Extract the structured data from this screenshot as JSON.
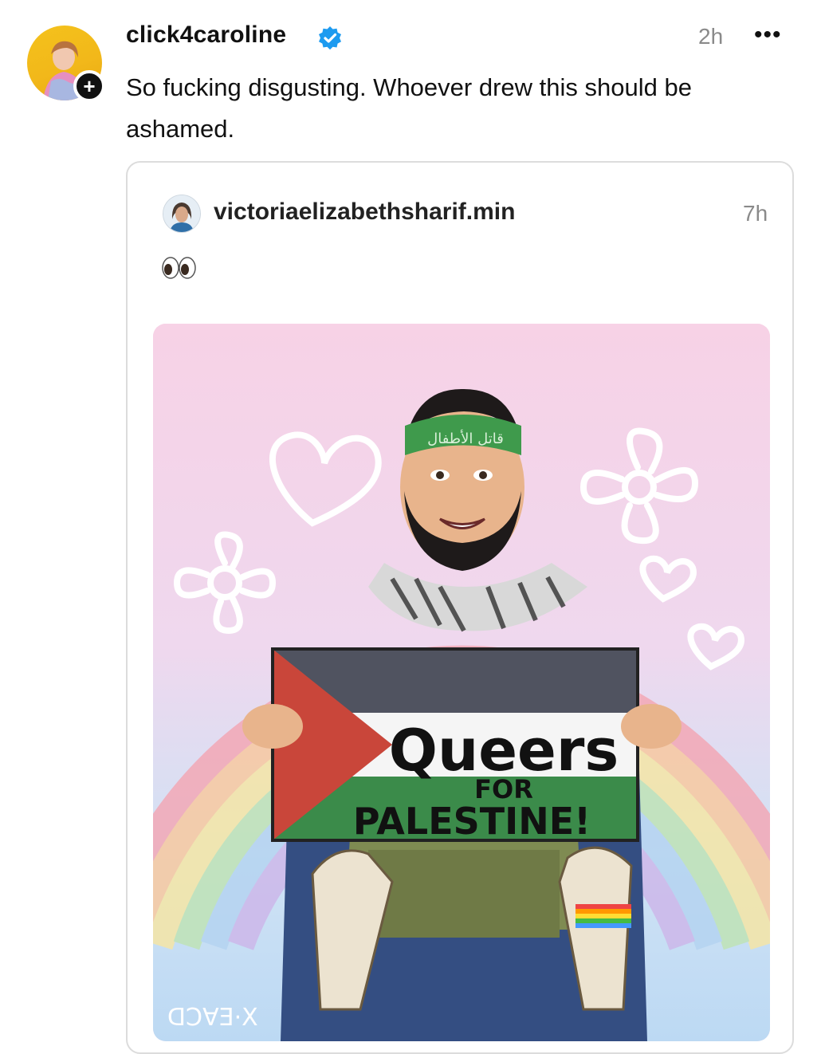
{
  "post": {
    "username": "click4caroline",
    "verified_icon": "verified-badge-icon",
    "time": "2h",
    "more_label": "•••",
    "follow_label": "+",
    "text": "So fucking disgusting. Whoever drew this should be ashamed."
  },
  "quoted": {
    "username": "victoriaelizabethsharif.min",
    "time": "7h",
    "emoji": "eyes-emoji",
    "image": {
      "headband_text": "قاتل الأطفال",
      "sign_line1": "Queers",
      "sign_line2": "FOR",
      "sign_line3": "PALESTINE!",
      "signature": "ᗡƆ∀Ǝ·X"
    }
  },
  "colors": {
    "verified_blue": "#1d9bf0",
    "muted_gray": "#8a8a8a",
    "flag_red": "#c9463a",
    "flag_green": "#3b8b4a",
    "flag_black": "#505360"
  }
}
